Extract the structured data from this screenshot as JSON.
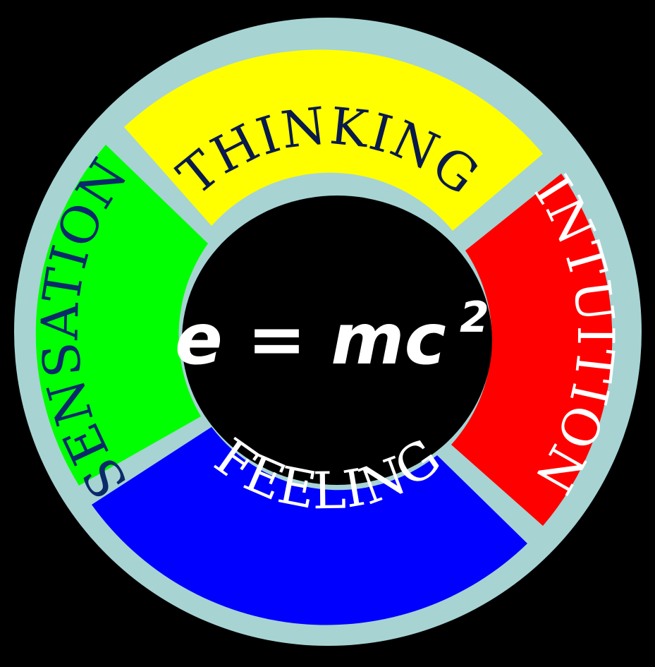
{
  "diagram": {
    "segments": [
      {
        "id": "thinking",
        "label": "THINKING",
        "color": "#ffff00",
        "text_color": "#0a1a4a"
      },
      {
        "id": "intuition",
        "label": "INTUITION",
        "color": "#ff0000",
        "text_color": "#ffffff"
      },
      {
        "id": "feeling",
        "label": "FEELING",
        "color": "#0000ff",
        "text_color": "#ffffff"
      },
      {
        "id": "sensation",
        "label": "SENSATION",
        "color": "#00ff00",
        "text_color": "#0a2a6a"
      }
    ],
    "ring_color": "#a7d3d3",
    "center_color": "#000000",
    "formula": {
      "base": "e = mc",
      "exponent": "2"
    }
  }
}
